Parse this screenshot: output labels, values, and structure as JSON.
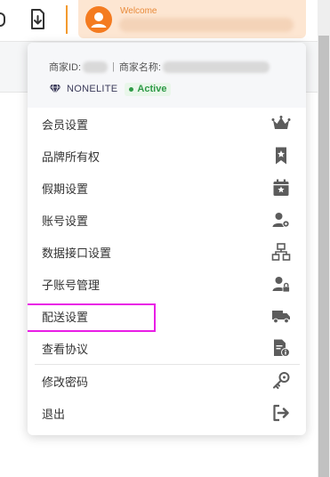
{
  "header": {
    "welcome_label": "Welcome"
  },
  "account": {
    "merchant_id_label": "商家ID:",
    "merchant_name_label": "商家名称:",
    "separator": "|",
    "plan_name": "NONELITE",
    "status": "Active"
  },
  "menu": {
    "items": [
      {
        "label": "会员设置",
        "icon": "crown-icon"
      },
      {
        "label": "品牌所有权",
        "icon": "bookmark-star-icon"
      },
      {
        "label": "假期设置",
        "icon": "calendar-star-icon"
      },
      {
        "label": "账号设置",
        "icon": "user-gear-icon"
      },
      {
        "label": "数据接口设置",
        "icon": "network-icon"
      },
      {
        "label": "子账号管理",
        "icon": "user-lock-icon"
      },
      {
        "label": "配送设置",
        "icon": "truck-icon"
      },
      {
        "label": "查看协议",
        "icon": "document-info-icon"
      }
    ],
    "footer_items": [
      {
        "label": "修改密码",
        "icon": "key-icon"
      },
      {
        "label": "退出",
        "icon": "logout-icon"
      }
    ]
  },
  "colors": {
    "accent_orange": "#f47b20",
    "welcome_bg": "#fde6d2",
    "active_green": "#2e9a47",
    "highlight_magenta": "#e91ee6",
    "icon_gray": "#5c5c5c"
  }
}
